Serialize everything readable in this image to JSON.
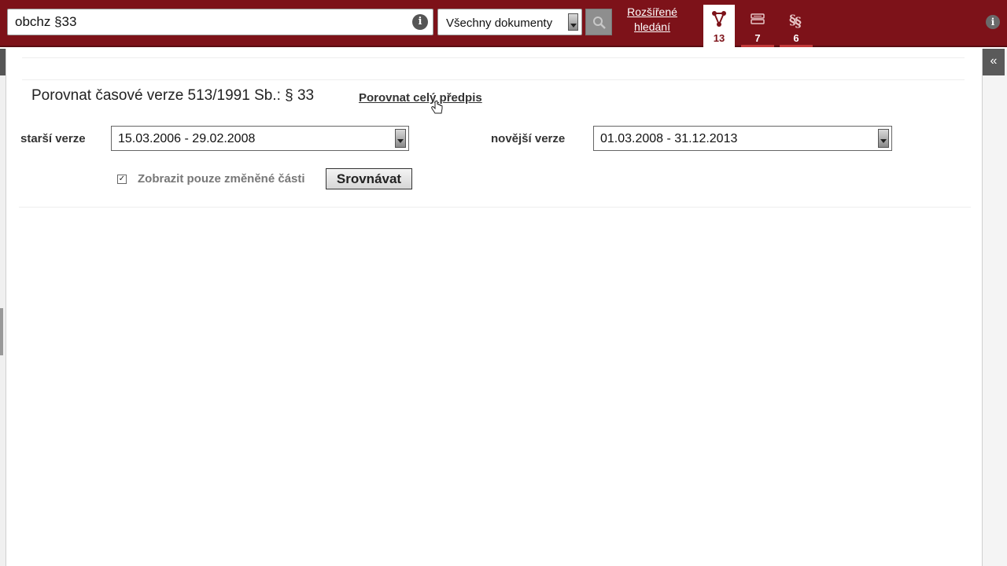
{
  "search": {
    "query": "obchz §33",
    "info_glyph": "i",
    "scope_value": "Všechny dokumenty",
    "advanced_link": "Rozšířené hledání"
  },
  "tabs": [
    {
      "icon": "graph-nodes-icon",
      "count": "13",
      "active": true
    },
    {
      "icon": "document-list-icon",
      "count": "7",
      "active": false
    },
    {
      "icon": "paragraph-sections-icon",
      "count": "6",
      "active": false
    }
  ],
  "top_info_glyph": "i",
  "collapse_glyph": "«",
  "compare": {
    "heading": "Porovnat časové verze 513/1991 Sb.: § 33",
    "whole_link": "Porovnat celý předpis",
    "older_label": "starší verze",
    "older_value": "15.03.2006 - 29.02.2008",
    "newer_label": "novější verze",
    "newer_value": "01.03.2008 - 31.12.2013",
    "only_changed_label": "Zobrazit pouze změněné části",
    "only_changed_checked": true,
    "submit_label": "Srovnávat"
  },
  "colors": {
    "topbar": "#7d1219",
    "accent": "#c23a3a"
  }
}
